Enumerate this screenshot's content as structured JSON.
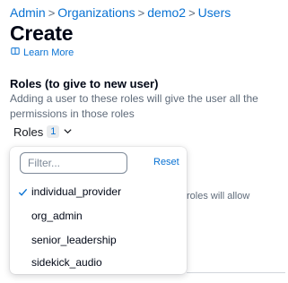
{
  "breadcrumb": {
    "items": [
      "Admin",
      "Organizations",
      "demo2",
      "Users"
    ],
    "separator": ">"
  },
  "page": {
    "title": "Create",
    "learn_more": "Learn More"
  },
  "roles": {
    "title": "Roles (to give to new user)",
    "description": "Adding a user to these roles will give the user all the permissions in those roles",
    "toggle_label": "Roles",
    "selected_count": "1",
    "background_hint": "roles will allow"
  },
  "dropdown": {
    "filter_placeholder": "Filter...",
    "filter_value": "",
    "reset_label": "Reset",
    "options": [
      {
        "label": "individual_provider",
        "selected": true
      },
      {
        "label": "org_admin",
        "selected": false
      },
      {
        "label": "senior_leadership",
        "selected": false
      },
      {
        "label": "sidekick_audio",
        "selected": false
      }
    ]
  },
  "colors": {
    "link": "#0972d3",
    "text": "#000716",
    "muted": "#5f6b7a"
  }
}
